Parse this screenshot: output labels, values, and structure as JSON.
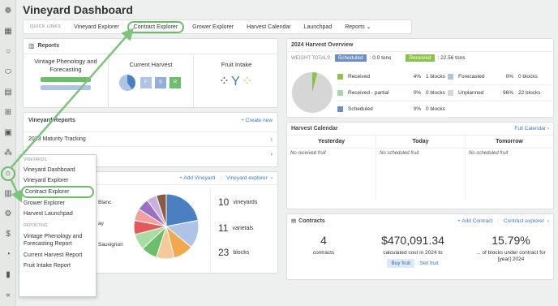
{
  "title": "Vineyard Dashboard",
  "quick_links": {
    "label": "QUICK LINKS",
    "items": [
      "Vineyard Explorer",
      "Contract Explorer",
      "Grower Explorer",
      "Harvest Calendar",
      "Launchpad",
      "Reports"
    ],
    "reports_caret": "⌄"
  },
  "reports": {
    "title": "Reports",
    "items": [
      {
        "title": "Vintage Phenology and Forecasting"
      },
      {
        "title": "Current Harvest",
        "bars": [
          "F",
          "S",
          "R"
        ]
      },
      {
        "title": "Fruit Intake"
      }
    ]
  },
  "vineyard_reports": {
    "title": "Vineyard Reports",
    "create": "Create new",
    "row": "2023 Maturity Tracking"
  },
  "menu": {
    "vineyards": "VINEYARDS",
    "items": [
      "Vineyard Dashboard",
      "Vineyard Explorer",
      "Contract Explorer",
      "Grower Explorer",
      "Harvest Launchpad"
    ],
    "reporting": "REPORTING",
    "reports": [
      "Vintage Phenology and Forecasting Report",
      "Current Harvest Report",
      "Fruit Intake Report"
    ]
  },
  "vineyards_card": {
    "add": "Add Vineyard",
    "explorer": "Vineyard explorer",
    "partial_labels": [
      "Blanc",
      "ay",
      "Sauvignon"
    ],
    "stats": [
      {
        "n": "10",
        "l": "vineyards"
      },
      {
        "n": "11",
        "l": "varietals"
      },
      {
        "n": "23",
        "l": "blocks"
      }
    ]
  },
  "overview": {
    "title": "2024 Harvest Overview",
    "weight_totals": "WEIGHT TOTALS:",
    "scheduled": "Scheduled",
    "scheduled_val": ": 0.0 tons",
    "received": "Received",
    "received_val": ": 22.56 tons",
    "rows": [
      {
        "label": "Received",
        "pct": "4%",
        "blocks": "1 blocks",
        "color": "#8bc34a"
      },
      {
        "label": "Received - partial",
        "pct": "0%",
        "blocks": "0 blocks",
        "color": "#a5d6a7"
      },
      {
        "label": "Scheduled",
        "pct": "0%",
        "blocks": "0 blocks",
        "color": "#6d8fc4"
      }
    ],
    "rows2": [
      {
        "label": "Forecasted",
        "pct": "0%",
        "blocks": "0 blocks",
        "color": "#aec3e0"
      },
      {
        "label": "Unplanned",
        "pct": "96%",
        "blocks": "22 blocks",
        "color": "#d6d6d6"
      }
    ]
  },
  "calendar": {
    "title": "Harvest Calendar",
    "full": "Full Calendar",
    "cols": [
      {
        "h": "Yesterday",
        "v": "No received fruit"
      },
      {
        "h": "Today",
        "v": "No scheduled fruit"
      },
      {
        "h": "Tomorrow",
        "v": "No scheduled fruit"
      }
    ]
  },
  "contracts": {
    "title": "Contracts",
    "add": "Add Contract",
    "explorer": "Contract explorer",
    "stats": [
      {
        "n": "4",
        "l": "contracts"
      },
      {
        "n": "$470,091.34",
        "l": "calculated cost in 2024 to"
      },
      {
        "n": "15.79%",
        "l": "... of blocks under contract for [year] 2024"
      }
    ],
    "buy": "Buy fruit",
    "sell": "Sell fruit"
  },
  "pie_colors": [
    "#4a7fc1",
    "#aec3e6",
    "#f2a84c",
    "#f5c99a",
    "#6abf69",
    "#a9dca0",
    "#e05a5a",
    "#f2a0a0",
    "#9b6fc4",
    "#c9b0e0",
    "#8a5a44"
  ]
}
